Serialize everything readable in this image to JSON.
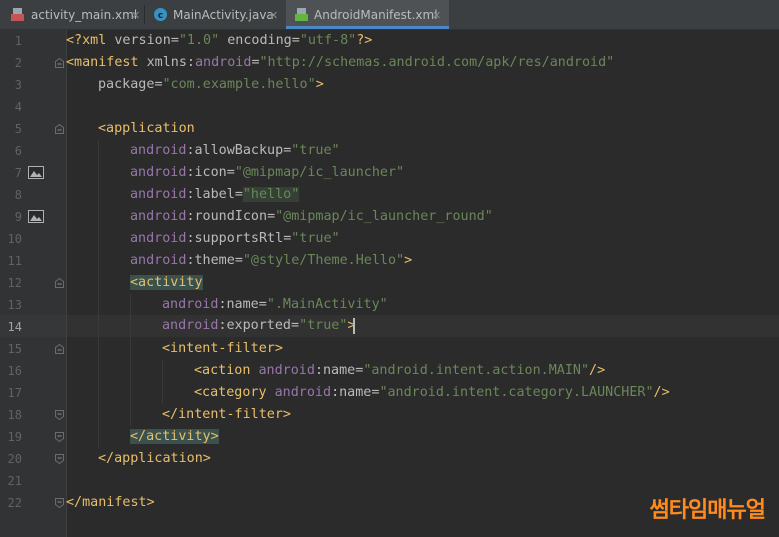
{
  "tabs": [
    {
      "label": "activity_main.xml",
      "icon": "xml-layout-icon",
      "active": false
    },
    {
      "label": "MainActivity.java",
      "icon": "java-class-icon",
      "active": false
    },
    {
      "label": "AndroidManifest.xml",
      "icon": "manifest-file-icon",
      "active": true
    }
  ],
  "tab_close_glyph": "✕",
  "gutter": {
    "line_numbers": [
      "1",
      "2",
      "3",
      "4",
      "5",
      "6",
      "7",
      "8",
      "9",
      "10",
      "11",
      "12",
      "13",
      "14",
      "15",
      "16",
      "17",
      "18",
      "19",
      "20",
      "21",
      "22"
    ],
    "current_line": "14"
  },
  "code": {
    "l1": {
      "a": "<?xml ",
      "b": "version",
      "c": "=",
      "d": "\"1.0\"",
      "e": " ",
      "f": "encoding",
      "g": "=",
      "h": "\"utf-8\"",
      "i": "?>"
    },
    "l2": {
      "a": "<manifest ",
      "b": "xmlns:",
      "c": "android",
      "d": "=",
      "e": "\"http://schemas.android.com/apk/res/android\""
    },
    "l3": {
      "a": "package",
      "b": "=",
      "c": "\"com.example.hello\"",
      "d": ">"
    },
    "l5": {
      "a": "<application"
    },
    "l6": {
      "ns": "android",
      "attr": ":allowBackup",
      "eq": "=",
      "val": "\"true\""
    },
    "l7": {
      "ns": "android",
      "attr": ":icon",
      "eq": "=",
      "val": "\"@mipmap/ic_launcher\""
    },
    "l8": {
      "ns": "android",
      "attr": ":label",
      "eq": "=",
      "val": "\"hello\""
    },
    "l9": {
      "ns": "android",
      "attr": ":roundIcon",
      "eq": "=",
      "val": "\"@mipmap/ic_launcher_round\""
    },
    "l10": {
      "ns": "android",
      "attr": ":supportsRtl",
      "eq": "=",
      "val": "\"true\""
    },
    "l11": {
      "ns": "android",
      "attr": ":theme",
      "eq": "=",
      "val": "\"@style/Theme.Hello\"",
      "end": ">"
    },
    "l12": {
      "a": "<activity"
    },
    "l13": {
      "ns": "android",
      "attr": ":name",
      "eq": "=",
      "val": "\".MainActivity\""
    },
    "l14": {
      "ns": "android",
      "attr": ":exported",
      "eq": "=",
      "val": "\"true\"",
      "end": ">"
    },
    "l15": {
      "a": "<intent-filter>"
    },
    "l16": {
      "a": "<action ",
      "ns": "android",
      "attr": ":name",
      "eq": "=",
      "val": "\"android.intent.action.MAIN\"",
      "end": "/>"
    },
    "l17": {
      "a": "<category ",
      "ns": "android",
      "attr": ":name",
      "eq": "=",
      "val": "\"android.intent.category.LAUNCHER\"",
      "end": "/>"
    },
    "l18": {
      "a": "</intent-filter>"
    },
    "l19": {
      "a": "</activity>"
    },
    "l20": {
      "a": "</application>"
    },
    "l22": {
      "a": "</manifest>"
    }
  },
  "watermark": "썸타임매뉴얼",
  "colors": {
    "background": "#2b2b2b",
    "tag": "#e8bf6a",
    "namespace": "#9876aa",
    "attribute": "#bababa",
    "string": "#6a8759",
    "watermark": "#ff8a1e"
  }
}
